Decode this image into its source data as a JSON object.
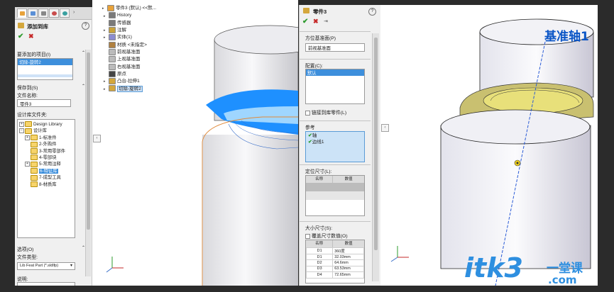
{
  "left_panel": {
    "title": "添加到库",
    "help": "?",
    "items_section": "要添加的项目(I)",
    "selected_item": "切除-旋转2",
    "save_to_section": "保存到(S)",
    "file_name_label": "文件名称:",
    "file_name_value": "零件3",
    "library_folder_label": "设计库文件夹:",
    "tree": [
      {
        "label": "Design Library",
        "level": 0,
        "toggle": "⊞"
      },
      {
        "label": "设计库",
        "level": 0,
        "toggle": "⊟"
      },
      {
        "label": "1-标准件",
        "level": 1,
        "toggle": "⊞"
      },
      {
        "label": "2-外购件",
        "level": 1,
        "toggle": ""
      },
      {
        "label": "3-常用零部件",
        "level": 1,
        "toggle": ""
      },
      {
        "label": "4-零部块",
        "level": 1,
        "toggle": ""
      },
      {
        "label": "5-常用注释",
        "level": 1,
        "toggle": "⊞"
      },
      {
        "label": "6-特征库",
        "level": 1,
        "toggle": "",
        "selected": true
      },
      {
        "label": "7-成型工具",
        "level": 1,
        "toggle": ""
      },
      {
        "label": "8-材质库",
        "level": 1,
        "toggle": ""
      }
    ],
    "options_section": "选项(O)",
    "file_type_label": "文件类型:",
    "file_type_value": "Lib Feat Part (*.sldlfp)",
    "description_label": "说明:"
  },
  "feature_tree": {
    "root": "零件3 (默认) <<默...",
    "items": [
      {
        "label": "History",
        "expandable": true
      },
      {
        "label": "传感器",
        "expandable": false
      },
      {
        "label": "注解",
        "expandable": true
      },
      {
        "label": "实体(1)",
        "expandable": true
      },
      {
        "label": "材质 <未指定>",
        "expandable": false
      },
      {
        "label": "前视基准面",
        "expandable": false
      },
      {
        "label": "上视基准面",
        "expandable": false
      },
      {
        "label": "右视基准面",
        "expandable": false
      },
      {
        "label": "原点",
        "expandable": false
      },
      {
        "label": "凸台-拉伸1",
        "expandable": true
      },
      {
        "label": "切除-旋转2",
        "expandable": true,
        "selected": true
      }
    ]
  },
  "right_panel": {
    "title": "零件3",
    "help": "?",
    "orientation_plane_label": "方位基准面(P)",
    "orientation_plane_value": "前视基准面",
    "configurations_label": "配置(C):",
    "configurations_selected": "默认",
    "link_to_library_part": "链接到库零件(L)",
    "references_label": "参考",
    "references": [
      "轴",
      "边线1"
    ],
    "locating_dimensions_label": "定位尺寸(L):",
    "table_headers": [
      "名称",
      "数值"
    ],
    "size_dimensions_label": "大小尺寸(S):",
    "override_dimension_values": "覆盖尺寸数值(O)",
    "size_dimensions": [
      {
        "name": "D1",
        "value": "360度"
      },
      {
        "name": "D1",
        "value": "32.03mm"
      },
      {
        "name": "D2",
        "value": "64.6mm"
      },
      {
        "name": "D3",
        "value": "63.53mm"
      },
      {
        "name": "D4",
        "value": "72.65mm"
      }
    ]
  },
  "model_view_2": {
    "annotation": "基准轴1"
  },
  "watermark": {
    "text": "itk3",
    "suffix": ".com",
    "brand": "一堂课"
  },
  "colors": {
    "selection_blue": "#3d8fdc",
    "cut_face_blue": "#1e90ff",
    "annotation_blue": "#0a55c6",
    "ring_yellow": "#e8e07a"
  }
}
